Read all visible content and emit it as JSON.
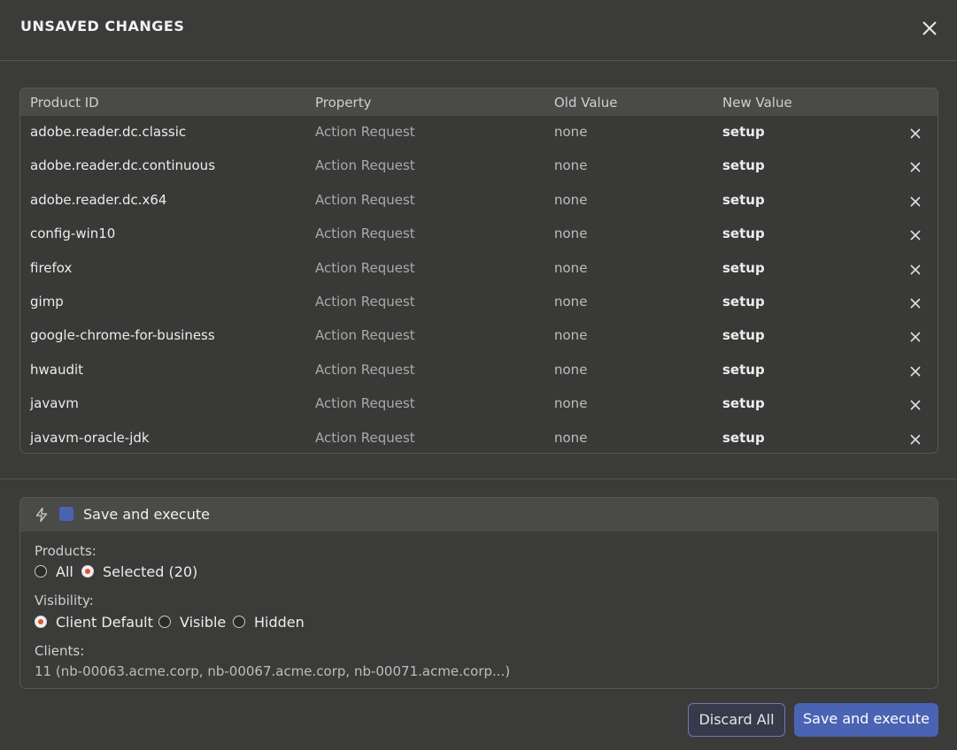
{
  "dialog": {
    "title": "UNSAVED CHANGES",
    "close_icon": "close-icon"
  },
  "table": {
    "headers": {
      "product_id": "Product ID",
      "property": "Property",
      "old_value": "Old Value",
      "new_value": "New Value"
    },
    "rows": [
      {
        "product_id": "adobe.reader.dc.classic",
        "property": "Action Request",
        "old_value": "none",
        "new_value": "setup"
      },
      {
        "product_id": "adobe.reader.dc.continuous",
        "property": "Action Request",
        "old_value": "none",
        "new_value": "setup"
      },
      {
        "product_id": "adobe.reader.dc.x64",
        "property": "Action Request",
        "old_value": "none",
        "new_value": "setup"
      },
      {
        "product_id": "config-win10",
        "property": "Action Request",
        "old_value": "none",
        "new_value": "setup"
      },
      {
        "product_id": "firefox",
        "property": "Action Request",
        "old_value": "none",
        "new_value": "setup"
      },
      {
        "product_id": "gimp",
        "property": "Action Request",
        "old_value": "none",
        "new_value": "setup"
      },
      {
        "product_id": "google-chrome-for-business",
        "property": "Action Request",
        "old_value": "none",
        "new_value": "setup"
      },
      {
        "product_id": "hwaudit",
        "property": "Action Request",
        "old_value": "none",
        "new_value": "setup"
      },
      {
        "product_id": "javavm",
        "property": "Action Request",
        "old_value": "none",
        "new_value": "setup"
      },
      {
        "product_id": "javavm-oracle-jdk",
        "property": "Action Request",
        "old_value": "none",
        "new_value": "setup"
      }
    ]
  },
  "execute": {
    "label": "Save and execute",
    "checked": true,
    "icon": "lightning-icon",
    "products_label": "Products:",
    "products_options": {
      "all": "All",
      "selected": "Selected (20)"
    },
    "products_selected": "selected",
    "visibility_label": "Visibility:",
    "visibility_options": {
      "client_default": "Client Default",
      "visible": "Visible",
      "hidden": "Hidden"
    },
    "visibility_selected": "client_default",
    "clients_label": "Clients:",
    "clients_value": "11  (nb-00063.acme.corp, nb-00067.acme.corp, nb-00071.acme.corp...)"
  },
  "footer": {
    "discard_label": "Discard All",
    "save_label": "Save and execute"
  },
  "colors": {
    "accent": "#4b63b3",
    "radio_selected": "#e0542c",
    "background": "#3b3b3a"
  }
}
